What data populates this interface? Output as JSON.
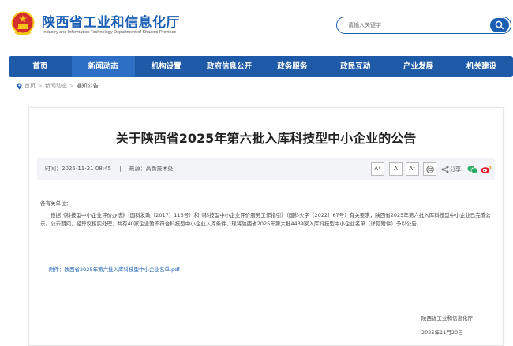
{
  "header": {
    "title": "陕西省工业和信息化厅",
    "subtitle": "Industry and Information Technology Department of Shaanxi Province",
    "search_placeholder": "请输入关键字",
    "colors": {
      "brand": "#1a5fb4",
      "nav": "#1e5aa8",
      "emblem_red": "#d32f2f",
      "emblem_gold": "#f5c518"
    }
  },
  "nav": {
    "items": [
      {
        "label": "首页"
      },
      {
        "label": "新闻动态"
      },
      {
        "label": "机构设置"
      },
      {
        "label": "政府信息公开"
      },
      {
        "label": "政务服务"
      },
      {
        "label": "政民互动"
      },
      {
        "label": "产业发展"
      },
      {
        "label": "机关建设"
      }
    ],
    "active_index": 1
  },
  "breadcrumb": {
    "items": [
      "首页",
      "新闻动态",
      "通知公告"
    ],
    "separator": ">"
  },
  "article": {
    "title": "关于陕西省2025年第六批入库科技型中小企业的公告",
    "meta": {
      "time": "时间：2025-11-21 08:45",
      "source": "来源：高新技术处",
      "font_sizes": [
        "A⁺",
        "A",
        "A⁻"
      ],
      "share_label": "分享:"
    },
    "salutation": "各有关单位：",
    "paragraph": "根据《科技型中小企业评价办法》（国科发政〔2017〕115号）和《科技型中小企业评价服务工作指引》（国科火字〔2022〕67号）有关要求，陕西省2025年第六批入库科技型中小企业已完成公示。公示期间，经异议核实处理，共有40家企业暂不符合科技型中小企业入库条件，现将陕西省2025年第六批4439家入库科技型中小企业名单（详见附件）予以公告。",
    "attachment": "附件：陕西省2025年第六批入库科技型中小企业名单.pdf",
    "signature_org": "陕西省工业和信息化厅",
    "signature_date": "2025年11月20日"
  }
}
